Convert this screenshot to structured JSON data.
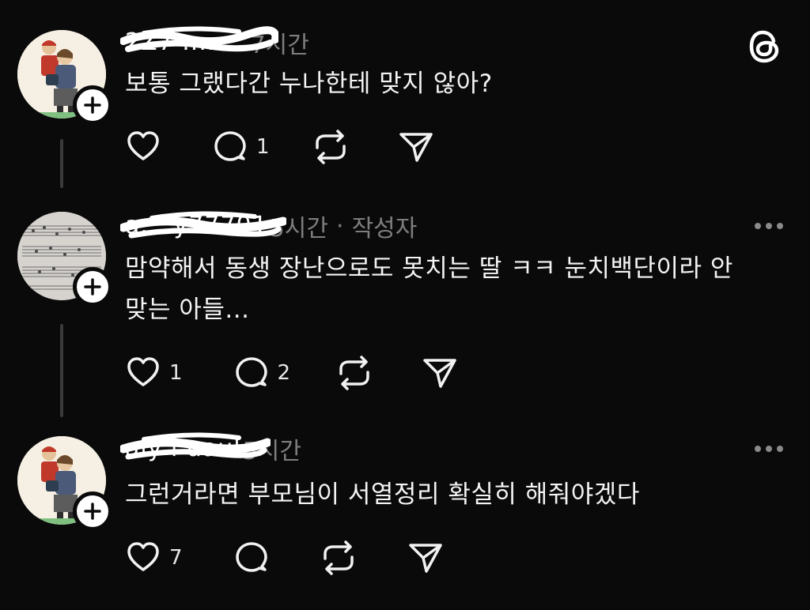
{
  "app": {
    "logo_icon": "threads-logo-icon"
  },
  "posts": [
    {
      "username": "2Z7 ........",
      "time": "7시간",
      "author_tag": "",
      "content": "보통 그랬다간 누나한테 맞지 않아?",
      "avatar": "cartoon-couple-avatar",
      "likes": "",
      "replies": "1",
      "has_more_menu": false
    },
    {
      "username": "a... y77701",
      "time": "5시간",
      "sep": "·",
      "author_tag": "작성자",
      "content": "맘약해서 동생 장난으로도 못치는 딸 ㅋㅋ 눈치백단이라 안\n맞는 아들...",
      "avatar": "sheet-music-avatar",
      "likes": "1",
      "replies": "2",
      "has_more_menu": true
    },
    {
      "username": "aly l uaul",
      "time": "5시간",
      "author_tag": "",
      "content": "그런거라면 부모님이 서열정리 확실히 해줘야겠다",
      "avatar": "cartoon-couple-avatar",
      "likes": "7",
      "replies": "",
      "has_more_menu": true
    }
  ],
  "icons": {
    "like": "heart-icon",
    "reply": "comment-bubble-icon",
    "repost": "repost-icon",
    "share": "send-icon",
    "follow": "plus-icon",
    "more": "more-dots-icon"
  },
  "colors": {
    "background": "#0a0a0a",
    "text": "#f4f4f4",
    "muted": "#7e7e7e",
    "thread_line": "#3a3a3a"
  }
}
